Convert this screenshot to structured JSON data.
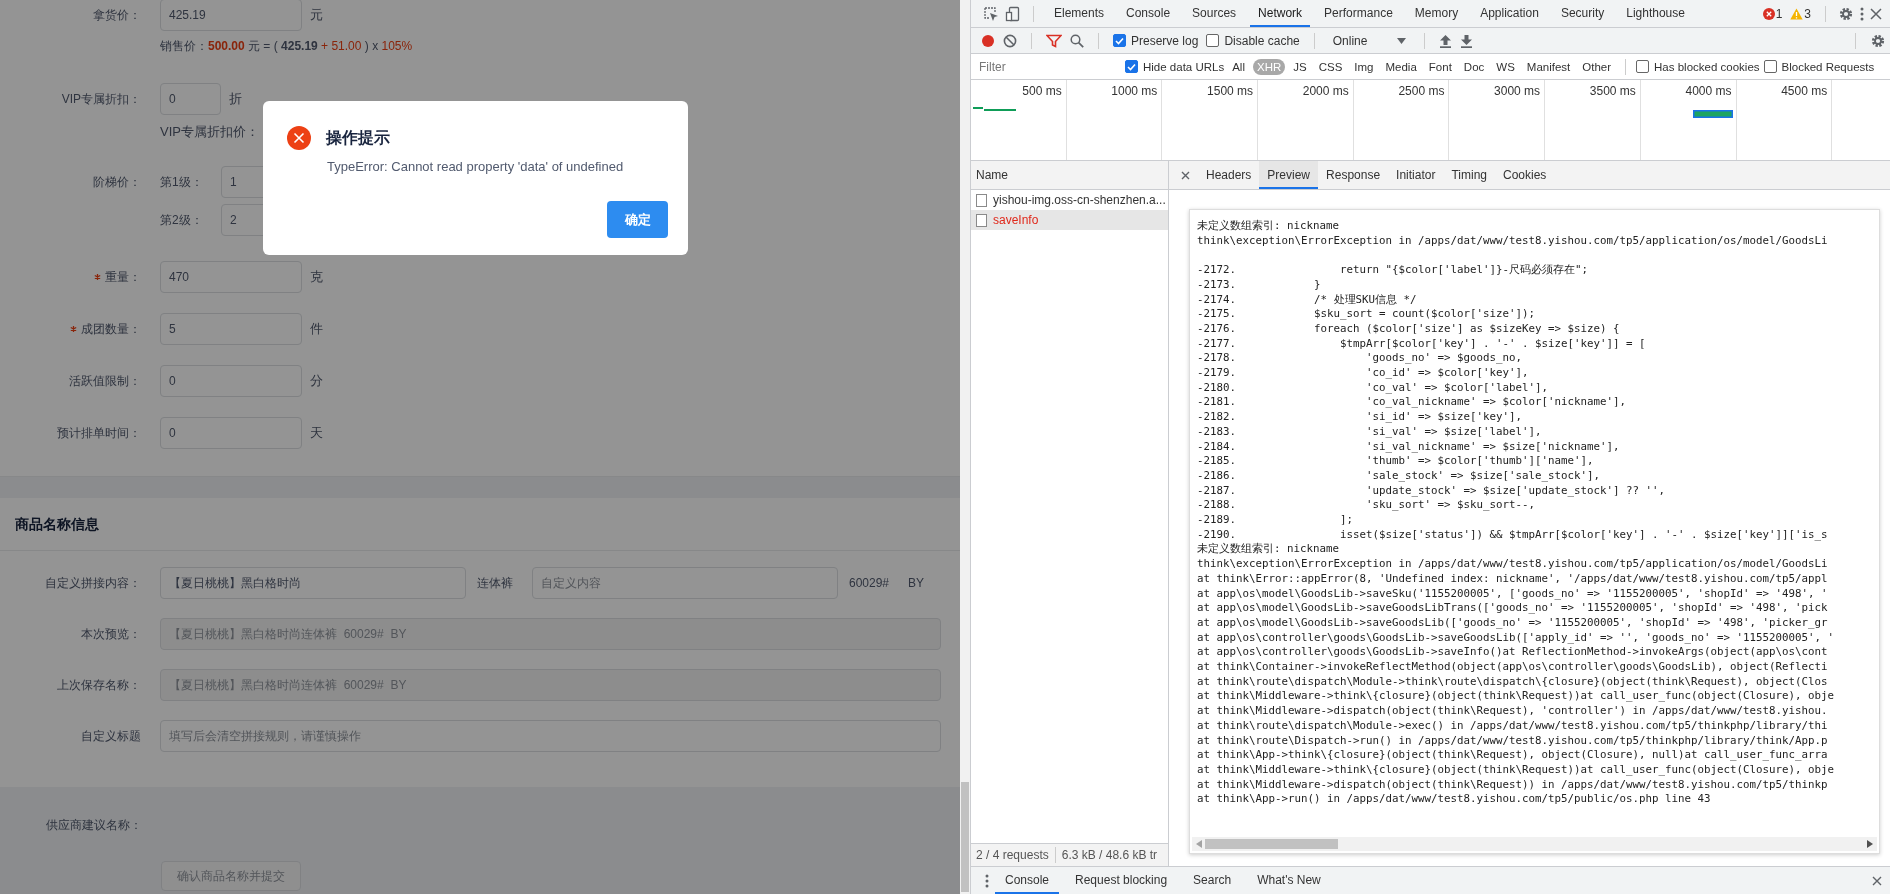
{
  "goods_form": {
    "rows": [
      {
        "kind": "field",
        "label": "拿货价：",
        "required": false,
        "value": "425.19",
        "unit": "元"
      },
      {
        "kind": "formula",
        "segments": [
          {
            "text": "销售价：",
            "highlighted": false
          },
          {
            "text": "**500.00**",
            "highlighted": true
          },
          {
            "text": " 元 = ( ",
            "highlighted": false
          },
          {
            "text": "**425.19**",
            "highlighted": false
          },
          {
            "text": " + 51.00",
            "highlighted": true
          },
          {
            "text": " ) x ",
            "highlighted": false
          },
          {
            "text": "105%",
            "highlighted": true
          }
        ]
      },
      {
        "kind": "short_field",
        "label": "VIP专属折扣：",
        "required": false,
        "value": "0",
        "unit": "折"
      },
      {
        "kind": "note",
        "text": "VIP专属折扣价："
      },
      {
        "kind": "tiers",
        "label": "阶梯价：",
        "tiers": [
          {
            "label": "第1级：",
            "value": "1"
          },
          {
            "label": "第2级：",
            "value": "2"
          }
        ]
      },
      {
        "kind": "field",
        "label": "重量：",
        "required": true,
        "value": "470",
        "unit": "克"
      },
      {
        "kind": "field",
        "label": "成团数量：",
        "required": true,
        "value": "5",
        "unit": "件"
      },
      {
        "kind": "field",
        "label": "活跃值限制：",
        "required": false,
        "value": "0",
        "unit": "分"
      },
      {
        "kind": "field",
        "label": "预计排单时间：",
        "required": false,
        "value": "0",
        "unit": "天"
      }
    ]
  },
  "name_section": {
    "title": "商品名称信息",
    "rows": [
      {
        "kind": "compose",
        "label": "自定义拼接内容：",
        "value": "【夏日桃桃】黑白格时尚",
        "middle": "连体裤",
        "placeholder": "自定义内容",
        "suffix": [
          "60029#",
          "BY"
        ]
      },
      {
        "kind": "readonly",
        "label": "本次预览：",
        "value": "【夏日桃桃】黑白格时尚连体裤  60029#  BY"
      },
      {
        "kind": "readonly",
        "label": "上次保存名称：",
        "value": "【夏日桃桃】黑白格时尚连体裤  60029#  BY"
      },
      {
        "kind": "input",
        "label": "自定义标题",
        "placeholder": "填写后会清空拼接规则，请谨慎操作"
      }
    ]
  },
  "supplier": {
    "label": "供应商建议名称：",
    "button": "确认商品名称并提交"
  },
  "dialog": {
    "title": "操作提示",
    "message": "TypeError: Cannot read property 'data' of undefined",
    "button": "确定"
  },
  "devtools": {
    "tabs": [
      {
        "label": "Elements",
        "selected": false
      },
      {
        "label": "Console",
        "selected": false
      },
      {
        "label": "Sources",
        "selected": false
      },
      {
        "label": "Network",
        "selected": true
      },
      {
        "label": "Performance",
        "selected": false
      },
      {
        "label": "Memory",
        "selected": false
      },
      {
        "label": "Application",
        "selected": false
      },
      {
        "label": "Security",
        "selected": false
      },
      {
        "label": "Lighthouse",
        "selected": false
      }
    ],
    "error_count": "1",
    "warning_count": "3",
    "toolbar": {
      "recording": true,
      "preserve_log": {
        "label": "Preserve log",
        "checked": true
      },
      "disable_cache": {
        "label": "Disable cache",
        "checked": false
      },
      "throttling": "Online"
    },
    "filter": {
      "placeholder": "Filter",
      "hide_data_urls": {
        "label": "Hide data URLs",
        "checked": true
      },
      "types": [
        {
          "label": "All",
          "selected": false
        },
        {
          "label": "XHR",
          "selected": true
        },
        {
          "label": "JS",
          "selected": false
        },
        {
          "label": "CSS",
          "selected": false
        },
        {
          "label": "Img",
          "selected": false
        },
        {
          "label": "Media",
          "selected": false
        },
        {
          "label": "Font",
          "selected": false
        },
        {
          "label": "Doc",
          "selected": false
        },
        {
          "label": "WS",
          "selected": false
        },
        {
          "label": "Manifest",
          "selected": false
        },
        {
          "label": "Other",
          "selected": false
        }
      ],
      "blocked_cookies": {
        "label": "Has blocked cookies",
        "checked": false
      },
      "blocked_requests": {
        "label": "Blocked Requests",
        "checked": false
      }
    },
    "timeline_ticks": [
      "500 ms",
      "1000 ms",
      "1500 ms",
      "2000 ms",
      "2500 ms",
      "3000 ms",
      "3500 ms",
      "4000 ms",
      "4500 ms"
    ],
    "requests": {
      "header": "Name",
      "items": [
        {
          "name": "yishou-img.oss-cn-shenzhen.a...",
          "selected": false,
          "failed": false
        },
        {
          "name": "saveInfo",
          "selected": true,
          "failed": true
        }
      ],
      "summary": [
        "2 / 4 requests",
        "6.3 kB / 48.6 kB tr"
      ]
    },
    "detail_tabs": [
      {
        "label": "Headers",
        "selected": false
      },
      {
        "label": "Preview",
        "selected": true
      },
      {
        "label": "Response",
        "selected": false
      },
      {
        "label": "Initiator",
        "selected": false
      },
      {
        "label": "Timing",
        "selected": false
      },
      {
        "label": "Cookies",
        "selected": false
      }
    ],
    "preview_blocks": [
      [
        "未定义数组索引: nickname",
        "think\\exception\\ErrorException in /apps/dat/www/test8.yishou.com/tp5/application/os/model/GoodsLi"
      ],
      [
        "-2172.                return \"{$color['label']}-尺码必须存在\";",
        "-2173.            }",
        "-2174.            /* 处理SKU信息 */",
        "-2175.            $sku_sort = count($color['size']);",
        "-2176.            foreach ($color['size'] as $sizeKey => $size) {",
        "-2177.                $tmpArr[$color['key'] . '-' . $size['key']] = [",
        "-2178.                    'goods_no' => $goods_no,",
        "-2179.                    'co_id' => $color['key'],",
        "-2180.                    'co_val' => $color['label'],",
        "-2181.                    'co_val_nickname' => $color['nickname'],",
        "-2182.                    'si_id' => $size['key'],",
        "-2183.                    'si_val' => $size['label'],",
        "-2184.                    'si_val_nickname' => $size['nickname'],",
        "-2185.                    'thumb' => $color['thumb']['name'],",
        "-2186.                    'sale_stock' => $size['sale_stock'],",
        "-2187.                    'update_stock' => $size['update_stock'] ?? '',",
        "-2188.                    'sku_sort' => $sku_sort--,",
        "-2189.                ];",
        "-2190.                isset($size['status']) && $tmpArr[$color['key'] . '-' . $size['key']]['is_s",
        "未定义数组索引: nickname",
        "think\\exception\\ErrorException in /apps/dat/www/test8.yishou.com/tp5/application/os/model/GoodsLi",
        "at think\\Error::appError(8, 'Undefined index: nickname', '/apps/dat/www/test8.yishou.com/tp5/appl",
        "at app\\os\\model\\GoodsLib->saveSku('1155200005', ['goods_no' => '1155200005', 'shopId' => '498', '",
        "at app\\os\\model\\GoodsLib->saveGoodsLibTrans(['goods_no' => '1155200005', 'shopId' => '498', 'pick",
        "at app\\os\\model\\GoodsLib->saveGoodsLib(['goods_no' => '1155200005', 'shopId' => '498', 'picker_gr",
        "at app\\os\\controller\\goods\\GoodsLib->saveGoodsLib(['apply_id' => '', 'goods_no' => '1155200005', '",
        "at app\\os\\controller\\goods\\GoodsLib->saveInfo()at ReflectionMethod->invokeArgs(object(app\\os\\cont",
        "at think\\Container->invokeReflectMethod(object(app\\os\\controller\\goods\\GoodsLib), object(Reflecti",
        "at think\\route\\dispatch\\Module->think\\route\\dispatch\\{closure}(object(think\\Request), object(Clos",
        "at think\\Middleware->think\\{closure}(object(think\\Request))at call_user_func(object(Closure), obje",
        "at think\\Middleware->dispatch(object(think\\Request), 'controller') in /apps/dat/www/test8.yishou.",
        "at think\\route\\dispatch\\Module->exec() in /apps/dat/www/test8.yishou.com/tp5/thinkphp/library/thi",
        "at think\\route\\Dispatch->run() in /apps/dat/www/test8.yishou.com/tp5/thinkphp/library/think/App.p",
        "at think\\App->think\\{closure}(object(think\\Request), object(Closure), null)at call_user_func_arra",
        "at think\\Middleware->think\\{closure}(object(think\\Request))at call_user_func(object(Closure), obje",
        "at think\\Middleware->dispatch(object(think\\Request)) in /apps/dat/www/test8.yishou.com/tp5/thinkp",
        "at think\\App->run() in /apps/dat/www/test8.yishou.com/tp5/public/os.php line 43"
      ]
    ],
    "drawer_tabs": [
      {
        "label": "Console",
        "selected": true
      },
      {
        "label": "Request blocking",
        "selected": false
      },
      {
        "label": "Search",
        "selected": false
      },
      {
        "label": "What's New",
        "selected": false
      }
    ]
  }
}
